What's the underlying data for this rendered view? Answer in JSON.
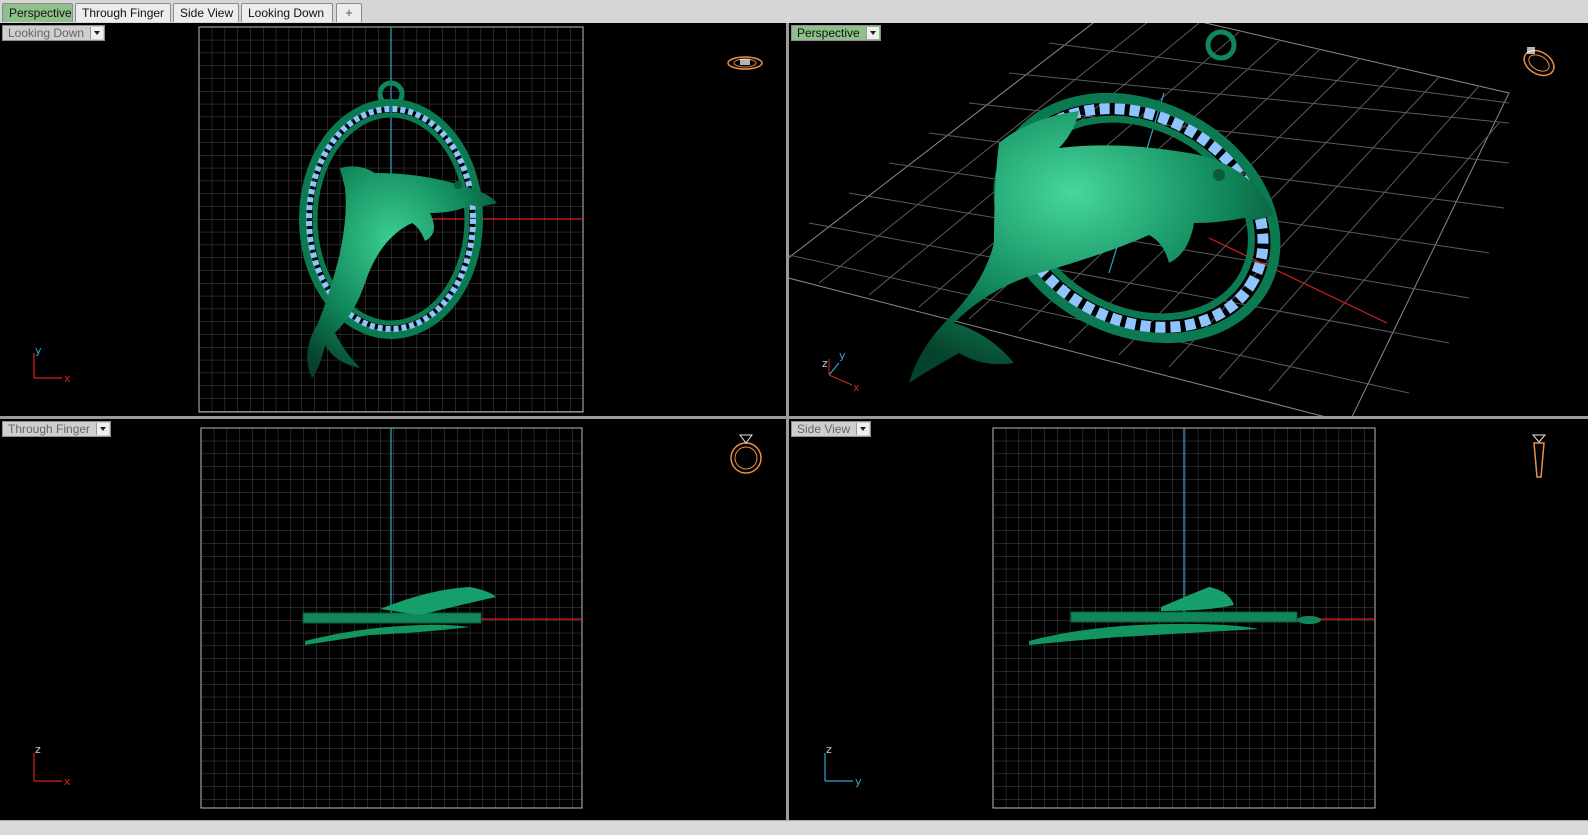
{
  "tabs": [
    {
      "label": "Perspective",
      "active": true
    },
    {
      "label": "Through Finger",
      "active": false
    },
    {
      "label": "Side View",
      "active": false
    },
    {
      "label": "Looking Down",
      "active": false
    }
  ],
  "add_tab_symbol": "+",
  "viewports": {
    "top_left": {
      "label": "Looking Down",
      "axes": [
        "y",
        "x"
      ],
      "icon": "ring-top-view-icon"
    },
    "top_right": {
      "label": "Perspective",
      "axes": [
        "z",
        "y",
        "x"
      ],
      "icon": "ring-perspective-icon"
    },
    "bottom_left": {
      "label": "Through Finger",
      "axes": [
        "z",
        "x"
      ],
      "icon": "ring-front-view-icon"
    },
    "bottom_right": {
      "label": "Side View",
      "axes": [
        "z",
        "y"
      ],
      "icon": "ring-side-view-icon"
    }
  },
  "colors": {
    "model": "#0f8a5c",
    "gem": "#8fc4ff",
    "grid": "#9a9a9a",
    "x_axis": "#d62020",
    "y_axis": "#2fa5d0",
    "active_tab": "#8fbf8a",
    "widget": "#e8904a"
  }
}
